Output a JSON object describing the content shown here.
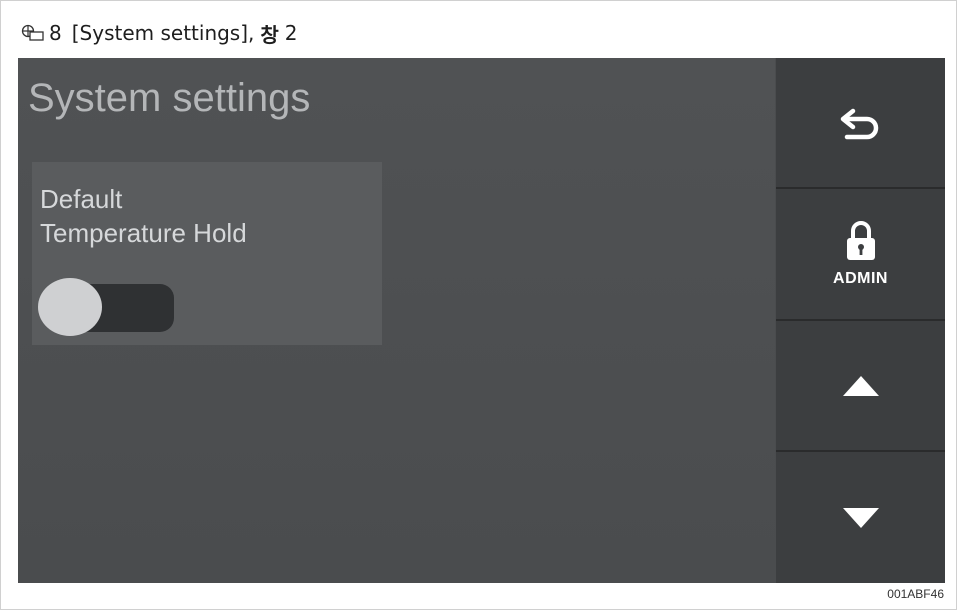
{
  "caption": {
    "figure_number": "8",
    "title": "[System settings],",
    "window_label": "창",
    "window_number": "2"
  },
  "screen": {
    "title": "System settings",
    "setting": {
      "label_line1": "Default",
      "label_line2": "Temperature Hold",
      "toggle_on": false
    }
  },
  "side_panel": {
    "back_icon": "back-arrow-icon",
    "lock_icon": "padlock-icon",
    "admin_label": "ADMIN",
    "up_icon": "triangle-up-icon",
    "down_icon": "triangle-down-icon"
  },
  "colors": {
    "screen_background": "#4a4c4e",
    "card_background": "#5a5c5e",
    "side_background": "#3c3e40",
    "toggle_track": "#2f3133",
    "toggle_knob": "#cfd0d2"
  },
  "footer_code": "001ABF46"
}
